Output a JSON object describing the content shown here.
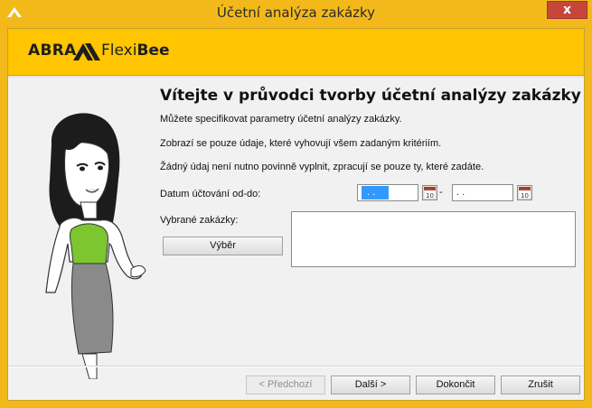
{
  "window": {
    "title": "Účetní analýza zakázky",
    "close_glyph": "x",
    "app_icon": "abra-chevron-icon"
  },
  "banner": {
    "logo_abra": "ABRA",
    "logo_flexi": "Flexi",
    "logo_bee": "Bee",
    "color": "#ffc500"
  },
  "wizard": {
    "heading": "Vítejte v průvodci tvorby účetní analýzy zakázky",
    "info_lines": [
      "Můžete specifikovat parametry účetní analýzy zakázky.",
      "Zobrazí se pouze údaje, které vyhovují všem zadaným kritériím.",
      "Žádný údaj není nutno povinně vyplnit, zpracují se pouze ty, které zadáte."
    ],
    "date_label": "Datum účtování od-do:",
    "date_from_value": ". .",
    "date_to_value": ". .",
    "date_separator": "-",
    "calendar_day": "10",
    "selected_label": "Vybrané zakázky:",
    "select_button": "Výběr"
  },
  "nav": {
    "prev": "< Předchozí",
    "next": "Další >",
    "finish": "Dokončit",
    "cancel": "Zrušit"
  }
}
